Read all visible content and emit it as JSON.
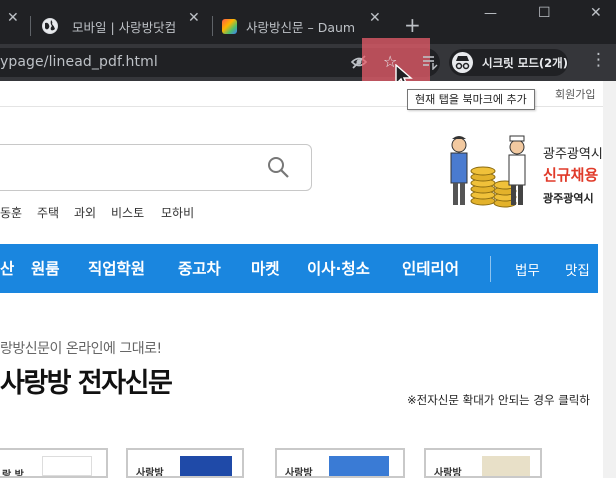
{
  "tabs": [
    {
      "title": ""
    },
    {
      "title": "모바일 | 사랑방닷컴"
    },
    {
      "title": "사랑방신문 – Daum"
    }
  ],
  "new_tab_symbol": "+",
  "window_controls": {
    "minimize": "—",
    "maximize": "☐",
    "close": "✕"
  },
  "address_bar": {
    "url": "ypage/linead_pdf.html"
  },
  "incognito": {
    "label": "시크릿 모드(2개)"
  },
  "tooltip": "현재 탭을 북마크에 추가",
  "page": {
    "top_link": "회원가입",
    "search_icon": "search-icon",
    "quick_links": [
      "동훈",
      "주택",
      "과외",
      "비스토",
      "모하비"
    ],
    "banner": {
      "line1": "광주광역시",
      "line2": "신규채용",
      "line3": "광주광역시"
    },
    "nav": {
      "items": [
        "산",
        "원룸",
        "직업학원",
        "중고차",
        "마켓",
        "이사·청소",
        "인테리어"
      ],
      "side_items": [
        "법무",
        "맛집"
      ],
      "bg_color": "#1a86df"
    },
    "section": {
      "subtitle": "랑방신문이 온라인에 그대로!",
      "title": "사랑방 전자신문",
      "notice": "※전자신문 확대가 안되는 경우 클릭하"
    },
    "thumbnails": [
      {
        "label": "랑 방"
      },
      {
        "label": "사랑방"
      },
      {
        "label": "사랑방"
      },
      {
        "label": "사랑방"
      }
    ]
  }
}
